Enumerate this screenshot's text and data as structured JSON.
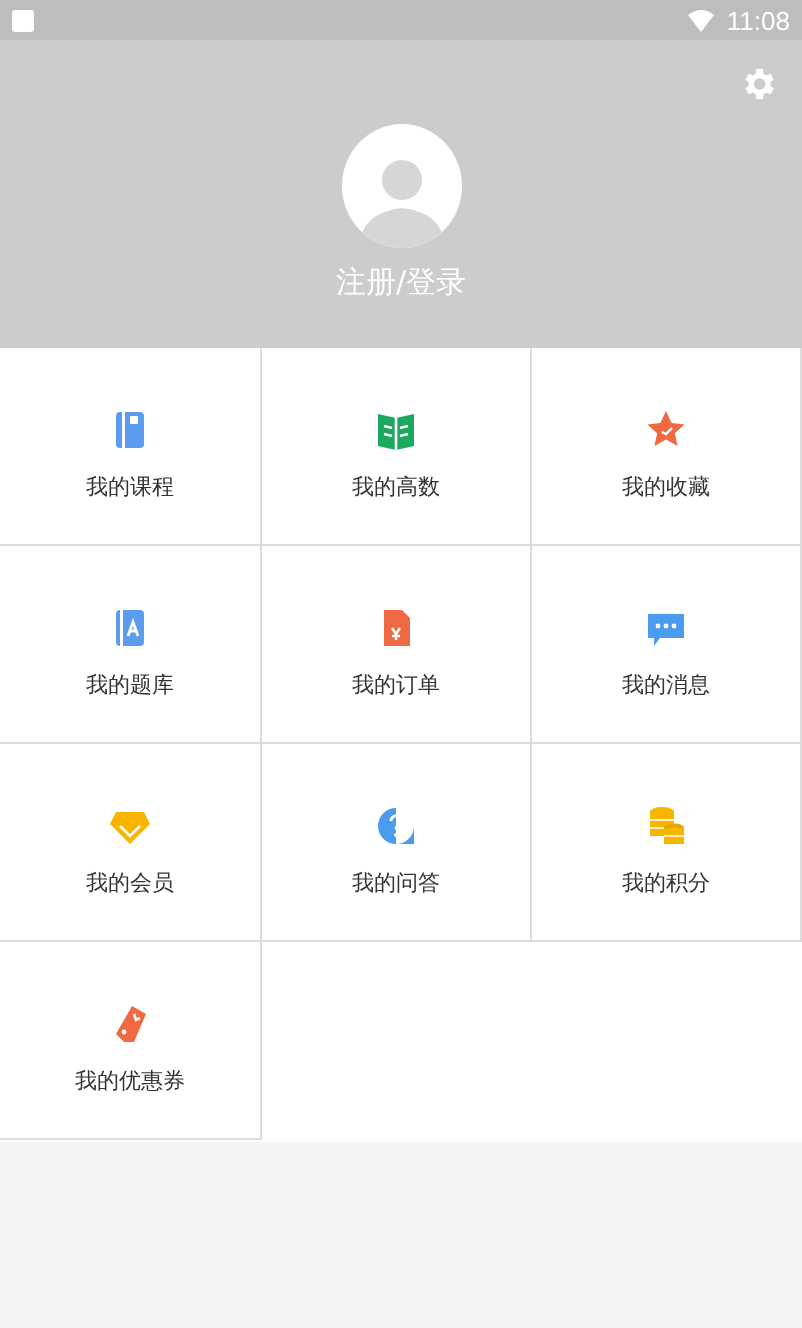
{
  "status_bar": {
    "time": "11:08"
  },
  "profile": {
    "login_label": "注册/登录"
  },
  "menu": [
    {
      "label": "我的课程",
      "kind": "course"
    },
    {
      "label": "我的高数",
      "kind": "math"
    },
    {
      "label": "我的收藏",
      "kind": "favorite"
    },
    {
      "label": "我的题库",
      "kind": "questions"
    },
    {
      "label": "我的订单",
      "kind": "order"
    },
    {
      "label": "我的消息",
      "kind": "message"
    },
    {
      "label": "我的会员",
      "kind": "member"
    },
    {
      "label": "我的问答",
      "kind": "qa"
    },
    {
      "label": "我的积分",
      "kind": "points"
    },
    {
      "label": "我的优惠券",
      "kind": "coupon"
    }
  ]
}
